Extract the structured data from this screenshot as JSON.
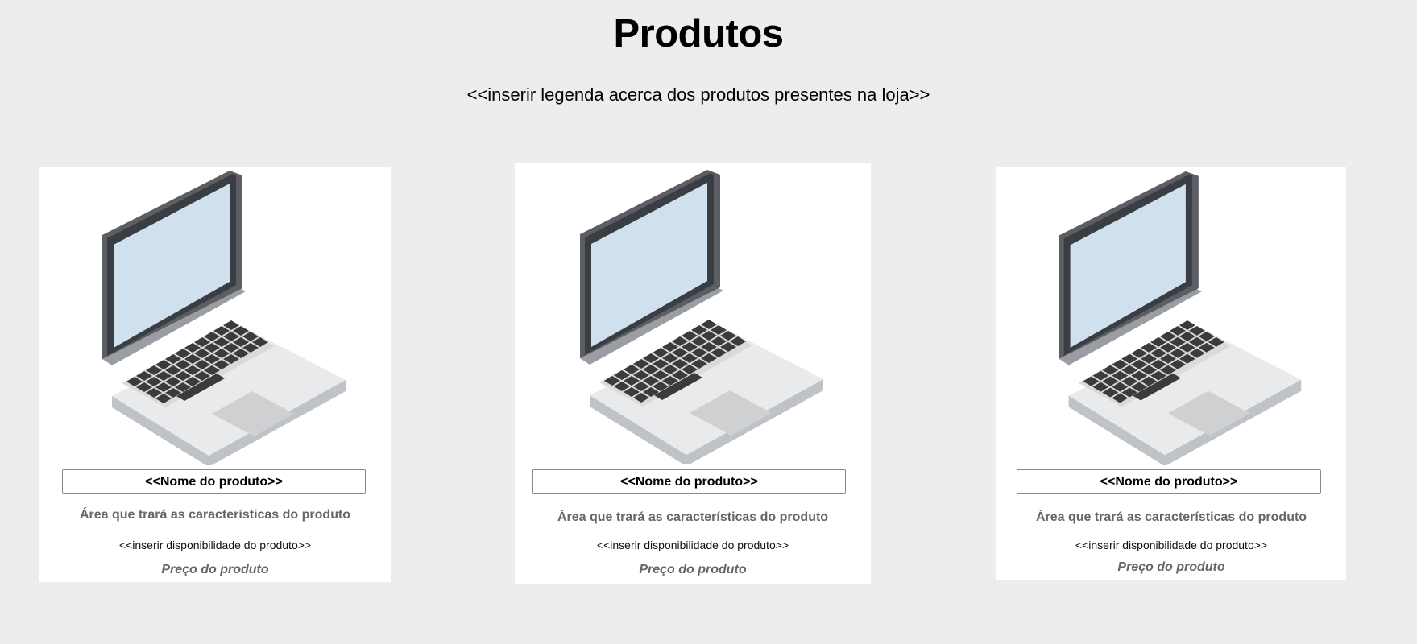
{
  "page": {
    "title": "Produtos",
    "subtitle": "<<inserir legenda acerca dos produtos presentes na loja>>"
  },
  "products": [
    {
      "image_icon": "laptop-icon",
      "name": "<<Nome do produto>>",
      "features": "Área que trará as características do produto",
      "availability": "<<inserir disponibilidade do produto>>",
      "price": "Preço do produto"
    },
    {
      "image_icon": "laptop-icon",
      "name": "<<Nome do produto>>",
      "features": "Área que trará as características do produto",
      "availability": "<<inserir disponibilidade do produto>>",
      "price": "Preço do produto"
    },
    {
      "image_icon": "laptop-icon",
      "name": "<<Nome do produto>>",
      "features": "Área que trará as características do produto",
      "availability": "<<inserir disponibilidade do produto>>",
      "price": "Preço do produto"
    }
  ],
  "colors": {
    "background": "#ededed",
    "card": "#ffffff",
    "screen": "#cfe1ef",
    "bezel": "#3a3d42",
    "body": "#e9eaec",
    "keys": "#3a3b3c",
    "trackpad": "#cfd0d2",
    "secondary_text": "#666666"
  }
}
